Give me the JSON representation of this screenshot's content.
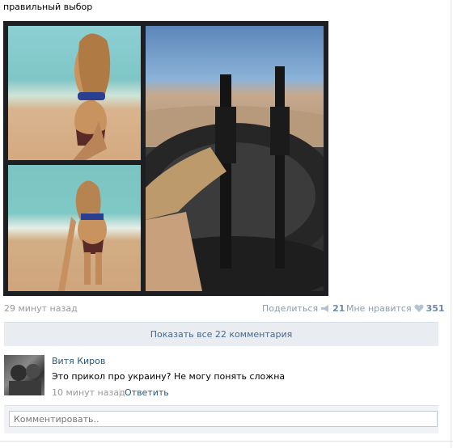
{
  "post": {
    "text": "правильный выбор"
  },
  "meta": {
    "time": "29 минут назад",
    "share_label": "Поделиться",
    "share_count": "21",
    "like_label": "Мне нравится",
    "like_count": "351"
  },
  "comments": {
    "show_all_label": "Показать все 22 комментария",
    "items": [
      {
        "author": "Витя Киров",
        "text": "Это прикол про украину? Не могу понять сложна",
        "time": "10 минут назад",
        "reply_label": "Ответить"
      }
    ]
  },
  "reply": {
    "placeholder": "Комментировать.."
  },
  "colors": {
    "link": "#2b587a",
    "muted": "#999999",
    "panel": "#e9edf1"
  }
}
